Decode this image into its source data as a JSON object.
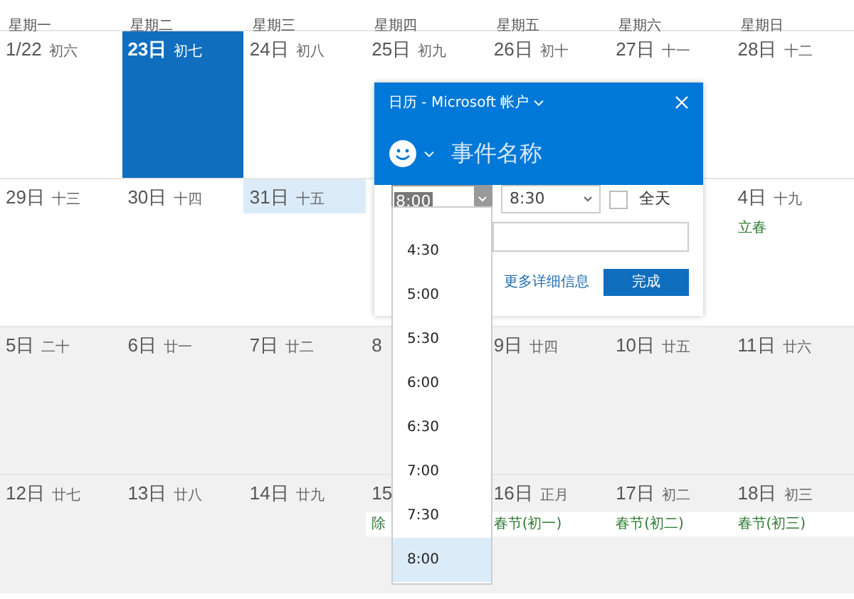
{
  "weekdays": [
    "星期一",
    "星期二",
    "星期三",
    "星期四",
    "星期五",
    "星期六",
    "星期日"
  ],
  "weeks": [
    {
      "dimmed": false,
      "cells": [
        {
          "date": "1/22",
          "lunar": "初六",
          "selected": false,
          "highlighted": false
        },
        {
          "date": "23日",
          "lunar": "初七",
          "selected": true,
          "highlighted": false
        },
        {
          "date": "24日",
          "lunar": "初八",
          "selected": false,
          "highlighted": false
        },
        {
          "date": "25日",
          "lunar": "初九",
          "selected": false,
          "highlighted": false
        },
        {
          "date": "26日",
          "lunar": "初十",
          "selected": false,
          "highlighted": false
        },
        {
          "date": "27日",
          "lunar": "十一",
          "selected": false,
          "highlighted": false
        },
        {
          "date": "28日",
          "lunar": "十二",
          "selected": false,
          "highlighted": false
        }
      ]
    },
    {
      "dimmed": false,
      "cells": [
        {
          "date": "29日",
          "lunar": "十三",
          "selected": false,
          "highlighted": false
        },
        {
          "date": "30日",
          "lunar": "十四",
          "selected": false,
          "highlighted": false
        },
        {
          "date": "31日",
          "lunar": "十五",
          "selected": false,
          "highlighted": true
        },
        null,
        null,
        null,
        {
          "date": "4日",
          "lunar": "十九",
          "selected": false,
          "highlighted": false,
          "events": [
            "立春"
          ]
        }
      ]
    },
    {
      "dimmed": true,
      "cells": [
        {
          "date": "5日",
          "lunar": "二十",
          "selected": false,
          "highlighted": false
        },
        {
          "date": "6日",
          "lunar": "廿一",
          "selected": false,
          "highlighted": false
        },
        {
          "date": "7日",
          "lunar": "廿二",
          "selected": false,
          "highlighted": false
        },
        {
          "date": "8",
          "selected": false,
          "highlighted": false
        },
        {
          "date": "9日",
          "lunar": "廿四",
          "selected": false,
          "highlighted": false
        },
        {
          "date": "10日",
          "lunar": "廿五",
          "selected": false,
          "highlighted": false
        },
        {
          "date": "11日",
          "lunar": "廿六",
          "selected": false,
          "highlighted": false
        }
      ]
    },
    {
      "dimmed": true,
      "cells": [
        {
          "date": "12日",
          "lunar": "廿七",
          "selected": false,
          "highlighted": false
        },
        {
          "date": "13日",
          "lunar": "廿八",
          "selected": false,
          "highlighted": false
        },
        {
          "date": "14日",
          "lunar": "廿九",
          "selected": false,
          "highlighted": false
        },
        {
          "date": "15",
          "selected": false,
          "highlighted": false,
          "events": [
            "除"
          ]
        },
        {
          "date": "16日",
          "lunar": "正月",
          "selected": false,
          "highlighted": false,
          "events": [
            "春节(初一)"
          ]
        },
        {
          "date": "17日",
          "lunar": "初二",
          "selected": false,
          "highlighted": false,
          "events": [
            "春节(初二)"
          ]
        },
        {
          "date": "18日",
          "lunar": "初三",
          "selected": false,
          "highlighted": false,
          "events": [
            "春节(初三)"
          ]
        }
      ]
    }
  ],
  "popup": {
    "account": "日历 - Microsoft 帐户",
    "title_placeholder": "事件名称",
    "start": "8:00",
    "end": "8:30",
    "all_day": {
      "label": "全天",
      "checked": false
    },
    "more_link": "更多详细信息",
    "done_button": "完成",
    "time_list": [
      {
        "label": "4:30",
        "selected": false
      },
      {
        "label": "5:00",
        "selected": false
      },
      {
        "label": "5:30",
        "selected": false
      },
      {
        "label": "6:00",
        "selected": false
      },
      {
        "label": "6:30",
        "selected": false
      },
      {
        "label": "7:00",
        "selected": false
      },
      {
        "label": "7:30",
        "selected": false
      },
      {
        "label": "8:00",
        "selected": true
      }
    ]
  }
}
